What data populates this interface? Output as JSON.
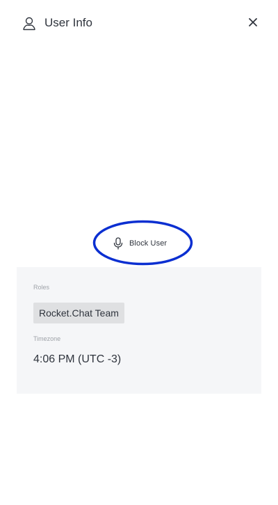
{
  "header": {
    "title": "User Info",
    "user_icon": "user-outline-icon",
    "close_icon": "close-icon"
  },
  "actions": {
    "block_user_label": "Block User",
    "block_user_icon": "microphone-icon"
  },
  "annotation": {
    "color": "#0b2fd1"
  },
  "info": {
    "roles_label": "Roles",
    "roles": [
      "Rocket.Chat Team"
    ],
    "timezone_label": "Timezone",
    "timezone_value": "4:06 PM (UTC -3)"
  }
}
